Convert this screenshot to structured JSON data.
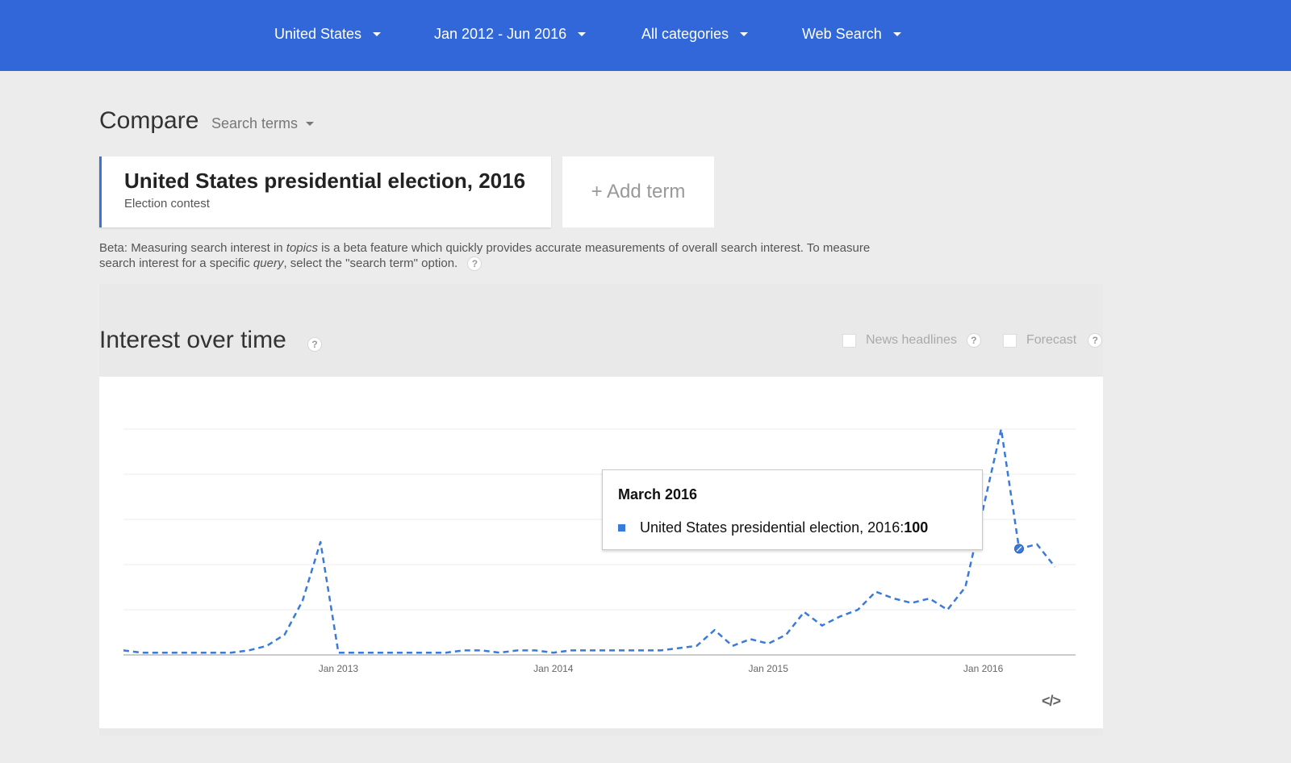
{
  "header": {
    "filters": [
      {
        "label": "United States"
      },
      {
        "label": "Jan 2012 - Jun 2016"
      },
      {
        "label": "All categories"
      },
      {
        "label": "Web Search"
      }
    ],
    "bg_color": "#3167d8"
  },
  "compare": {
    "title": "Compare",
    "mode_label": "Search terms",
    "term": {
      "name": "United States presidential election, 2016",
      "subtitle": "Election contest"
    },
    "add_term": "+ Add term",
    "beta_note_parts": {
      "p1": "Beta: Measuring search interest in ",
      "em1": "topics",
      "p2": " is a beta feature which quickly provides accurate measurements of overall search interest. To measure search interest for a specific ",
      "em2": "query",
      "p3": ", select the \"search term\" option."
    },
    "help_glyph": "?"
  },
  "interest": {
    "title": "Interest over time",
    "news_headlines": "News headlines",
    "forecast": "Forecast",
    "embed_icon": "</>"
  },
  "tooltip": {
    "title": "March 2016",
    "series": "United States presidential election, 2016",
    "sep": ": ",
    "value": "100"
  },
  "chart_data": {
    "type": "line",
    "line_style": "dashed",
    "color": "#3a7ad9",
    "grid": true,
    "ylim": [
      0,
      100
    ],
    "x_tick_labels": [
      "Jan 2013",
      "Jan 2014",
      "Jan 2015",
      "Jan 2016"
    ],
    "x_tick_months": [
      12,
      24,
      36,
      48
    ],
    "series": [
      {
        "name": "United States presidential election, 2016",
        "month_index": [
          0,
          1,
          2,
          3,
          4,
          5,
          6,
          7,
          8,
          9,
          10,
          11,
          12,
          13,
          14,
          15,
          16,
          17,
          18,
          19,
          19.5,
          20,
          21,
          22,
          23,
          24,
          25,
          26,
          27,
          28,
          29,
          30,
          31,
          32,
          33,
          34,
          35,
          36,
          37,
          38,
          39,
          40,
          41,
          42,
          43,
          44,
          45,
          46,
          47,
          48,
          49,
          50,
          51,
          52,
          53
        ],
        "values": [
          2,
          1,
          1,
          1,
          1,
          1,
          1,
          2,
          4,
          9,
          24,
          50,
          1,
          1,
          1,
          1,
          1,
          1,
          1,
          2,
          2,
          2,
          1,
          2,
          2,
          1,
          2,
          2,
          2,
          2,
          2,
          2,
          3,
          4,
          11,
          4,
          7,
          5,
          9,
          19,
          13,
          17,
          20,
          28,
          25,
          23,
          25,
          20,
          30,
          65,
          100,
          47,
          49,
          39
        ],
        "highlight_month": 50
      }
    ]
  }
}
